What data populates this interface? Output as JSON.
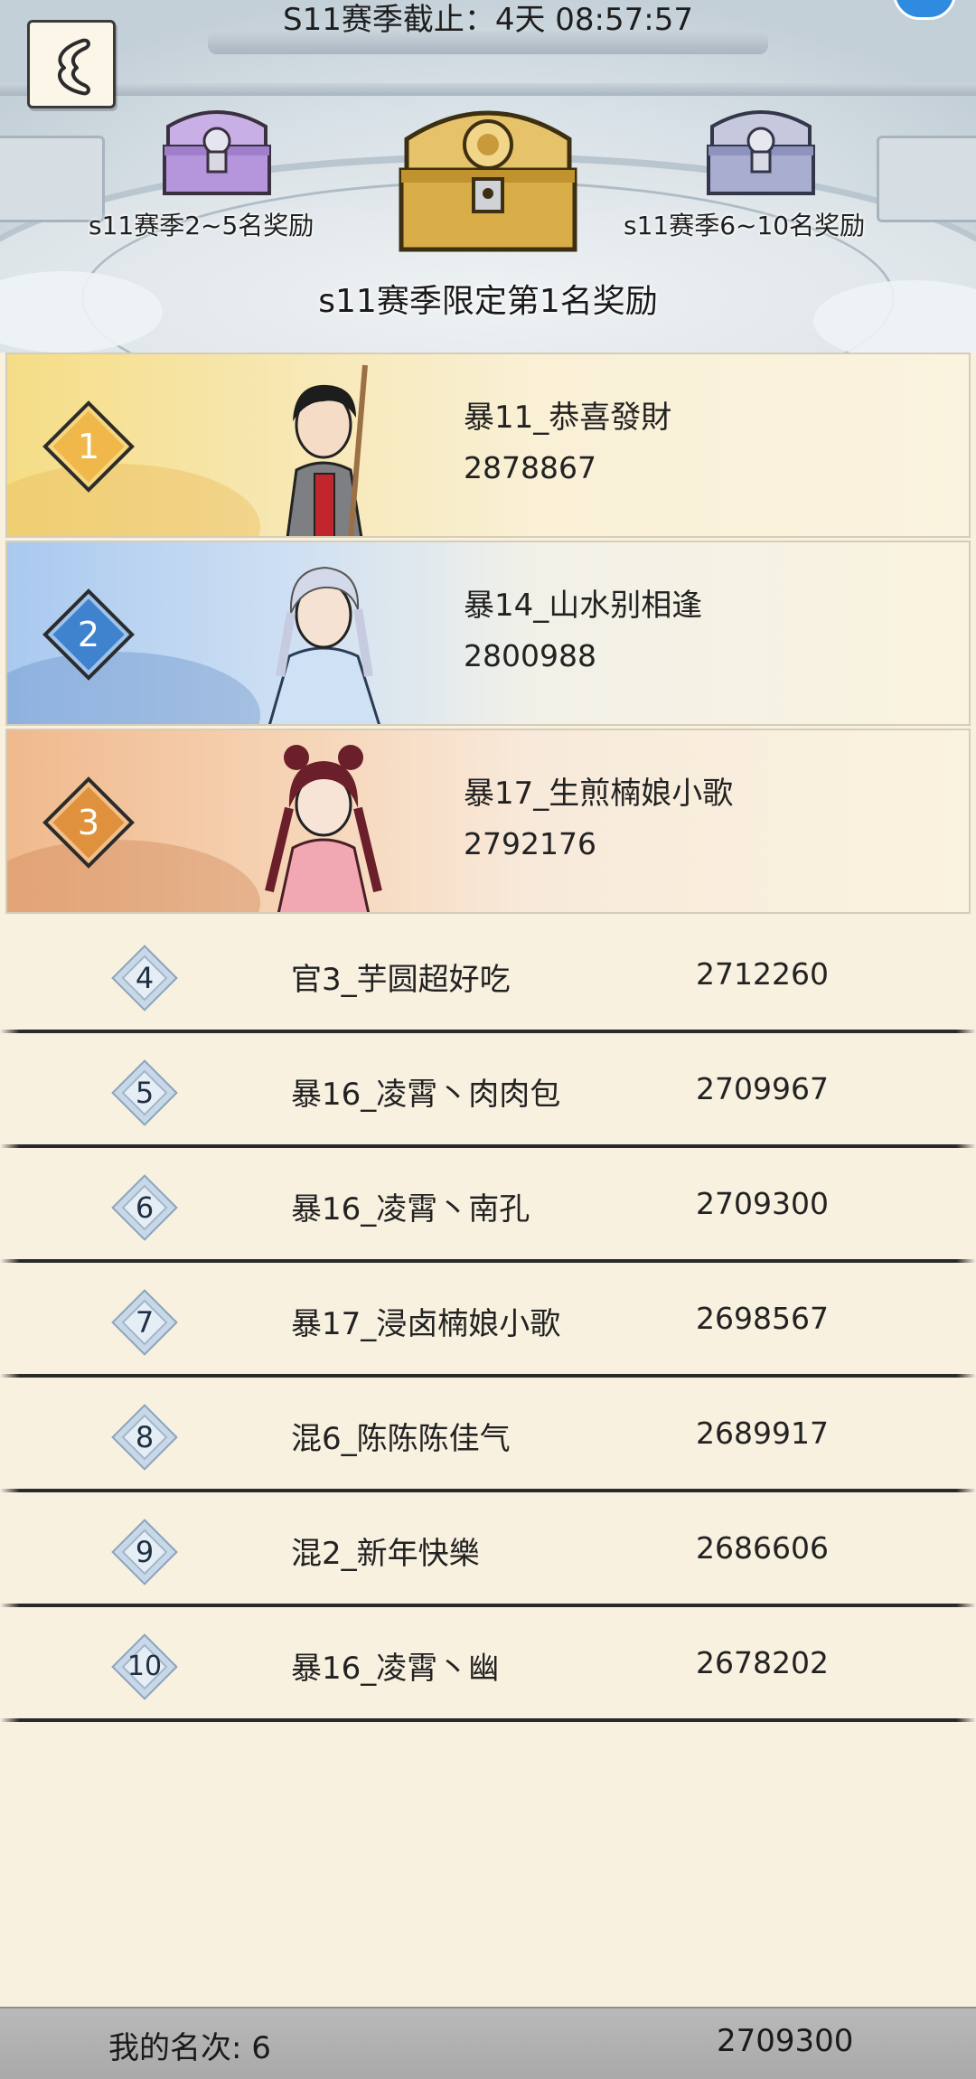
{
  "header": {
    "timer": "S11赛季截止：4天 08:57:57",
    "chest_left_label": "s11赛季2~5名奖励",
    "chest_main_label": "s11赛季限定第1名奖励",
    "chest_right_label": "s11赛季6~10名奖励"
  },
  "top3": [
    {
      "rank": "1",
      "name": "暴11_恭喜發財",
      "score": "2878867"
    },
    {
      "rank": "2",
      "name": "暴14_山水别相逢",
      "score": "2800988"
    },
    {
      "rank": "3",
      "name": "暴17_生煎楠娘小歌",
      "score": "2792176"
    }
  ],
  "ranks": [
    {
      "rank": "4",
      "name": "官3_芋圆超好吃",
      "score": "2712260"
    },
    {
      "rank": "5",
      "name": "暴16_凌霄丶肉肉包",
      "score": "2709967"
    },
    {
      "rank": "6",
      "name": "暴16_凌霄丶南孔",
      "score": "2709300"
    },
    {
      "rank": "7",
      "name": "暴17_浸卤楠娘小歌",
      "score": "2698567"
    },
    {
      "rank": "8",
      "name": "混6_陈陈陈佳气",
      "score": "2689917"
    },
    {
      "rank": "9",
      "name": "混2_新年快樂",
      "score": "2686606"
    },
    {
      "rank": "10",
      "name": "暴16_凌霄丶幽",
      "score": "2678202"
    }
  ],
  "my_rank": {
    "label": "我的名次: 6",
    "score": "2709300"
  },
  "colors": {
    "background": "#f8f1e0",
    "gold": "#f0b84a",
    "silver_blue": "#3f83cf",
    "bronze": "#e0913e",
    "footer": "#b0b0b0"
  },
  "icons": {
    "back": "back-arrow-icon",
    "chest": "treasure-chest-icon"
  }
}
